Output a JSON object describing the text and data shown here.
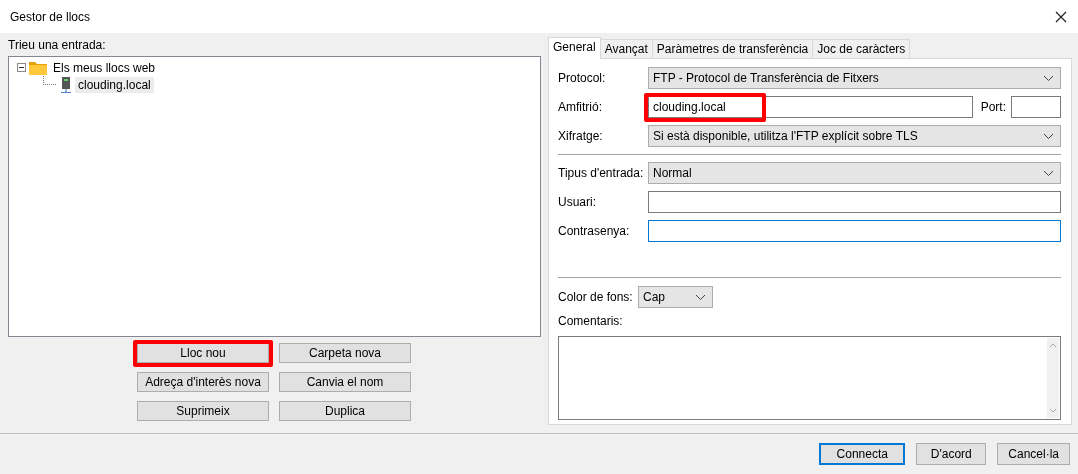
{
  "window": {
    "title": "Gestor de llocs"
  },
  "site_tree": {
    "label": "Trieu una entrada:",
    "items": [
      {
        "label": "Els meus llocs web",
        "kind": "folder",
        "expanded": true,
        "selected": false,
        "children": [
          {
            "label": "clouding.local",
            "kind": "site",
            "selected": true
          }
        ]
      }
    ]
  },
  "site_buttons": [
    {
      "label": "Lloc nou",
      "highlighted": true
    },
    {
      "label": "Carpeta nova",
      "highlighted": false
    },
    {
      "label": "Adreça d'interès nova",
      "highlighted": false
    },
    {
      "label": "Canvia el nom",
      "highlighted": false
    },
    {
      "label": "Suprimeix",
      "highlighted": false
    },
    {
      "label": "Duplica",
      "highlighted": false
    }
  ],
  "tabs": [
    {
      "label": "General",
      "selected": true
    },
    {
      "label": "Avançat",
      "selected": false
    },
    {
      "label": "Paràmetres de transferència",
      "selected": false
    },
    {
      "label": "Joc de caràcters",
      "selected": false
    }
  ],
  "general": {
    "protocol": {
      "label": "Protocol:",
      "value": "FTP - Protocol de Transferència de Fitxers"
    },
    "host": {
      "label": "Amfitrió:",
      "value": "clouding.local",
      "highlighted": true
    },
    "port": {
      "label": "Port:"
    },
    "encryption": {
      "label": "Xifratge:",
      "value": "Si està disponible, utilitza l'FTP explícit sobre TLS"
    },
    "logon_type": {
      "label": "Tipus d'entrada:",
      "value": "Normal"
    },
    "user": {
      "label": "Usuari:",
      "focused": false
    },
    "password": {
      "label": "Contrasenya:",
      "focused": true
    },
    "background_color": {
      "label": "Color de fons:",
      "value": "Cap"
    },
    "comments": {
      "label": "Comentaris:"
    }
  },
  "dialog_buttons": [
    {
      "label": "Connecta",
      "default": true
    },
    {
      "label": "D'acord",
      "default": false
    },
    {
      "label": "Cancel·la",
      "default": false
    }
  ]
}
